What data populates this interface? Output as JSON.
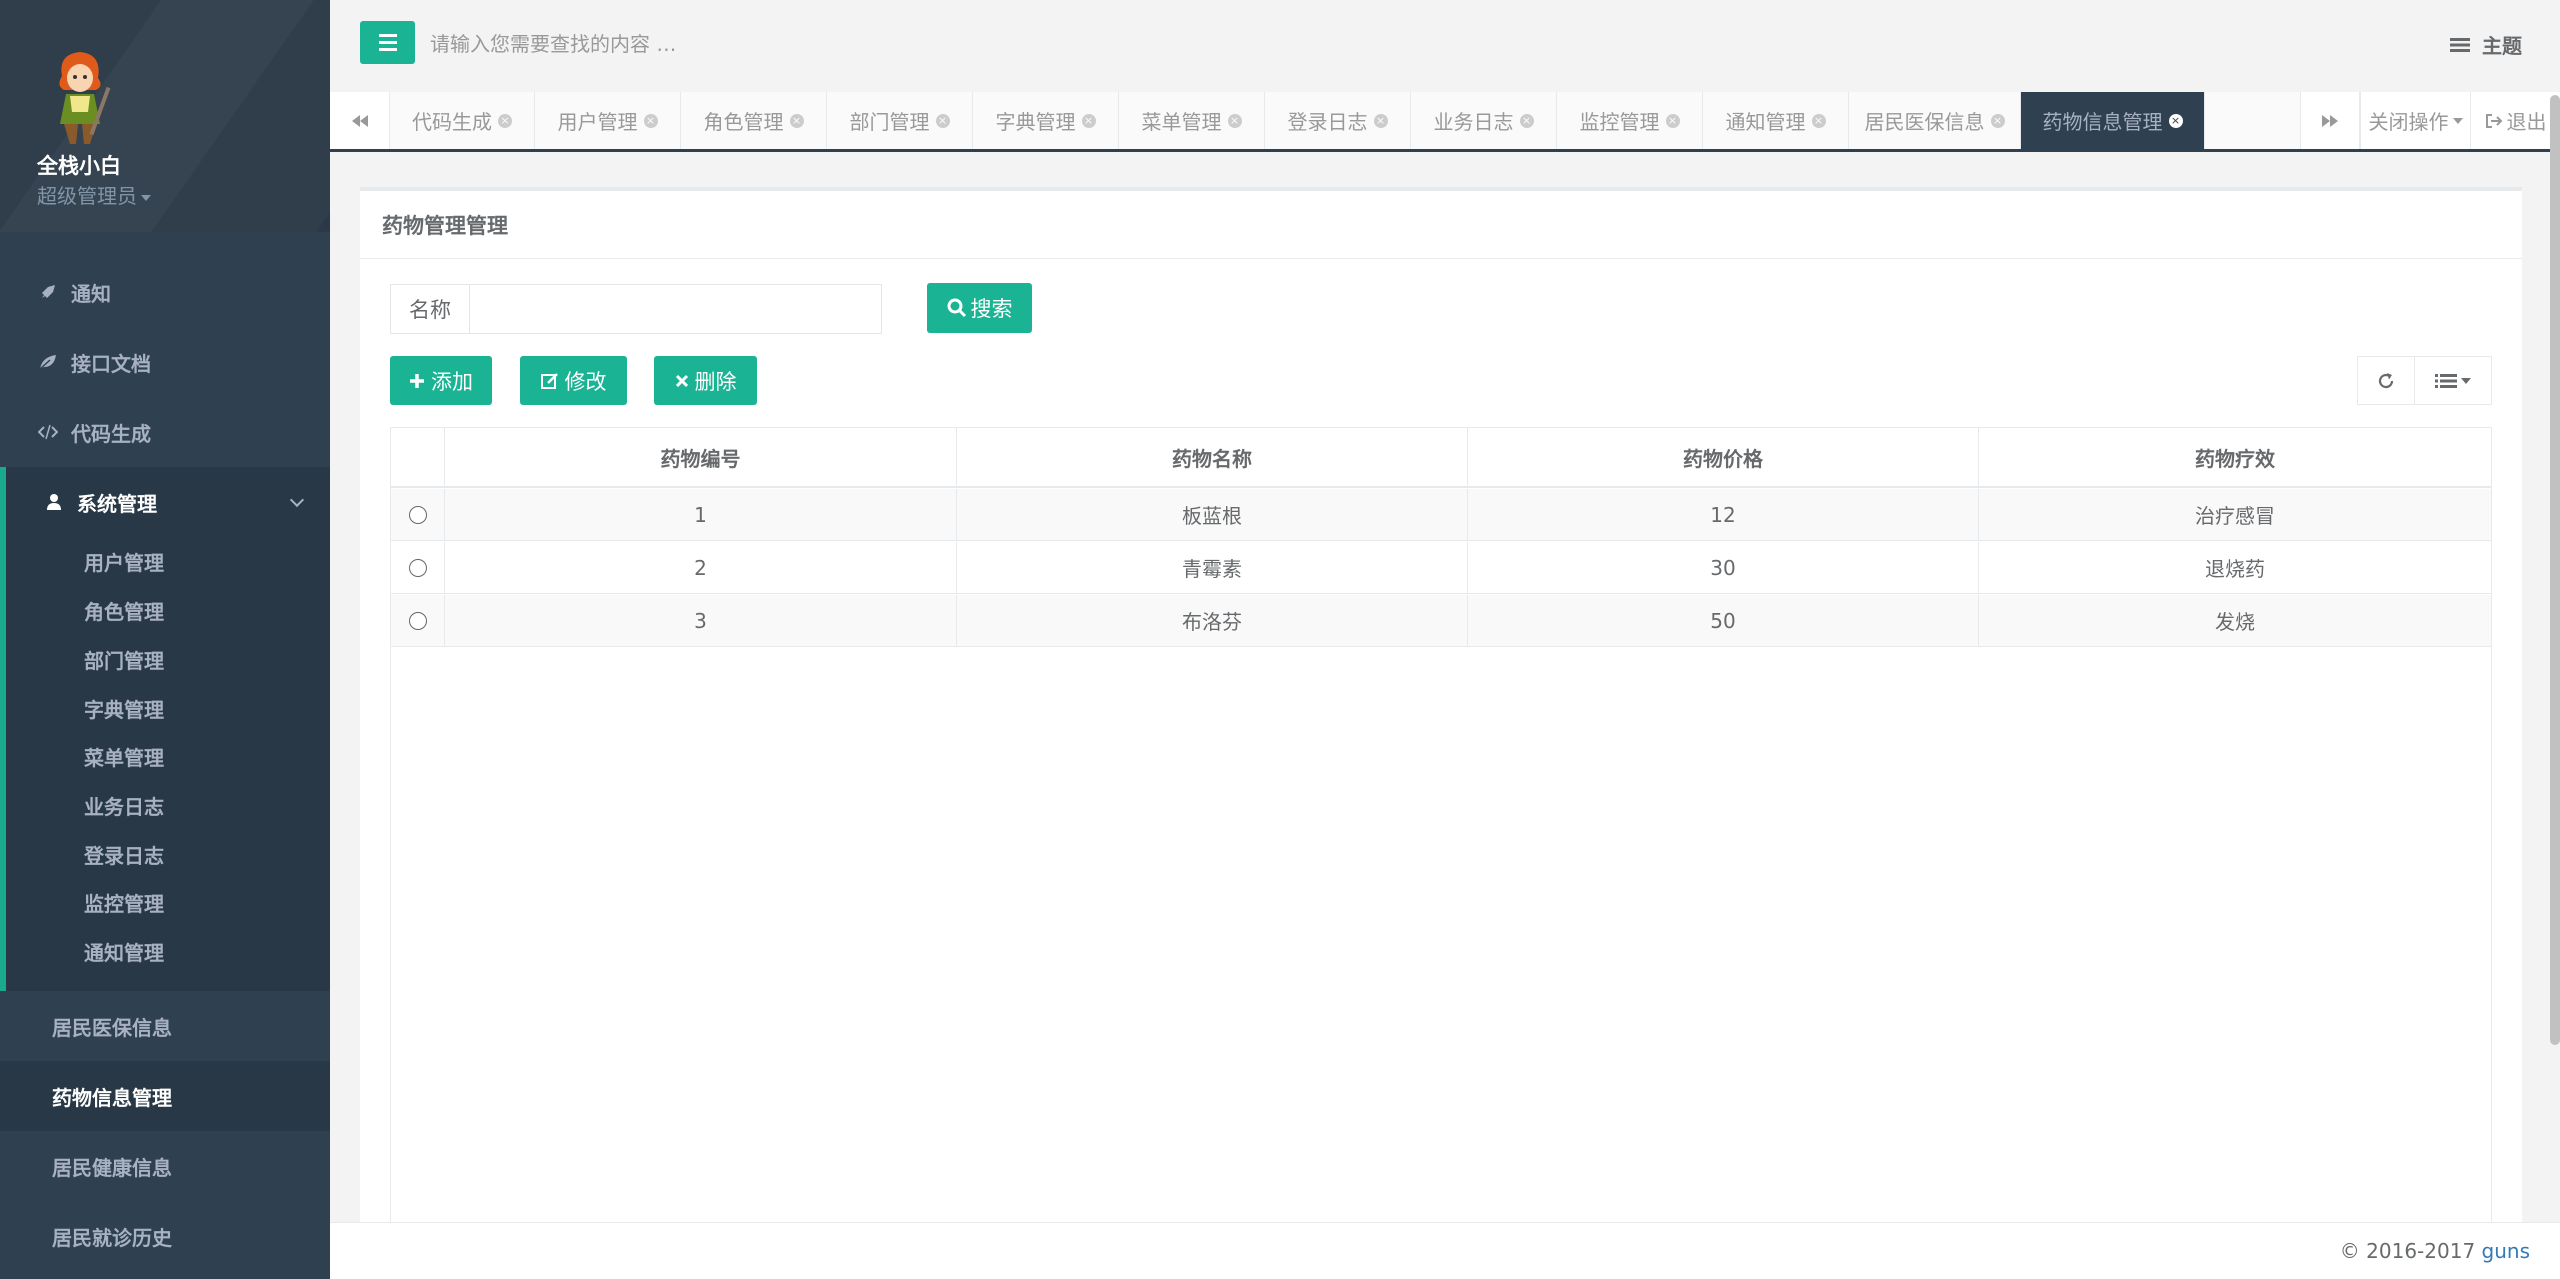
{
  "user": {
    "name": "全栈小白",
    "role": "超级管理员"
  },
  "sidebar": {
    "items": [
      {
        "label": "通知",
        "icon": "rocket-icon"
      },
      {
        "label": "接口文档",
        "icon": "leaf-icon"
      },
      {
        "label": "代码生成",
        "icon": "code-icon"
      }
    ],
    "system": {
      "label": "系统管理",
      "icon": "user-icon",
      "subitems": [
        "用户管理",
        "角色管理",
        "部门管理",
        "字典管理",
        "菜单管理",
        "业务日志",
        "登录日志",
        "监控管理",
        "通知管理"
      ]
    },
    "bottom_items": [
      "居民医保信息",
      "药物信息管理",
      "居民健康信息",
      "居民就诊历史"
    ]
  },
  "topbar": {
    "search_placeholder": "请输入您需要查找的内容 …",
    "theme_label": "主题"
  },
  "tabs": {
    "items": [
      "代码生成",
      "用户管理",
      "角色管理",
      "部门管理",
      "字典管理",
      "菜单管理",
      "登录日志",
      "业务日志",
      "监控管理",
      "通知管理",
      "居民医保信息",
      "药物信息管理"
    ],
    "active_index": 11,
    "close_ops_label": "关闭操作",
    "logout_label": "退出"
  },
  "panel": {
    "title": "药物管理管理",
    "search": {
      "label": "名称",
      "value": "",
      "button_label": "搜索"
    },
    "toolbar": {
      "add_label": "添加",
      "edit_label": "修改",
      "delete_label": "删除"
    }
  },
  "table": {
    "columns": [
      "药物编号",
      "药物名称",
      "药物价格",
      "药物疗效"
    ],
    "rows": [
      [
        "1",
        "板蓝根",
        "12",
        "治疗感冒"
      ],
      [
        "2",
        "青霉素",
        "30",
        "退烧药"
      ],
      [
        "3",
        "布洛芬",
        "50",
        "发烧"
      ]
    ]
  },
  "footer": {
    "copyright": "© 2016-2017",
    "brand": "guns"
  },
  "colors": {
    "sidebar": "#2f4050",
    "accent": "#1ab394",
    "active_tab": "#2f4050"
  }
}
